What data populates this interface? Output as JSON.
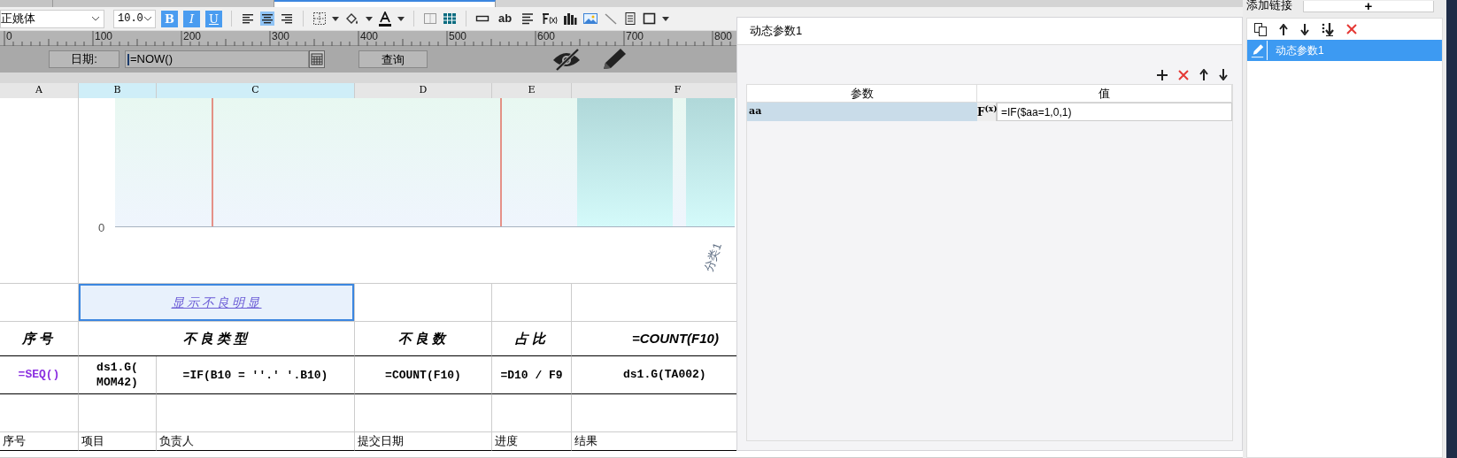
{
  "document_tabs": [
    {
      "selected": false
    },
    {
      "selected": false
    },
    {
      "selected": true
    }
  ],
  "toolbar": {
    "font": "正姚体",
    "size": "10.0",
    "format_buttons": [
      {
        "label": "B",
        "on": true
      },
      {
        "label": "I",
        "on": true
      },
      {
        "label": "U",
        "on": true
      }
    ],
    "align_buttons": [
      {
        "kind": "left",
        "selected": false
      },
      {
        "kind": "center",
        "selected": true
      },
      {
        "kind": "right",
        "selected": false
      }
    ],
    "text_tool": "ab"
  },
  "ruler": {
    "ticks": [
      "0",
      "100",
      "200",
      "300",
      "400",
      "500",
      "600",
      "700",
      "800"
    ]
  },
  "parameter_bar": {
    "label": "日期:",
    "value": "=NOW()",
    "button": "查询"
  },
  "sheet": {
    "columns": [
      {
        "label": "A",
        "selected": false
      },
      {
        "label": "B",
        "selected": true
      },
      {
        "label": "C",
        "selected": true
      },
      {
        "label": "D",
        "selected": false
      },
      {
        "label": "E",
        "selected": false
      },
      {
        "label": "F",
        "selected": false
      }
    ],
    "chart": {
      "y_tick": "0",
      "category": "分类1"
    },
    "rows": [
      {
        "cells": [
          {
            "kind": "plain",
            "selected": false
          },
          {
            "text": "显示不良明显",
            "kind": "link",
            "selected": true
          },
          {
            "kind": "merged"
          },
          {
            "kind": "plain",
            "selected": false
          },
          {
            "kind": "plain",
            "selected": false
          },
          {
            "kind": "plain",
            "selected": false
          }
        ]
      },
      {
        "cells": [
          {
            "text": "序号",
            "kind": "header",
            "selected": false
          },
          {
            "text": "不良类型",
            "kind": "header",
            "selected": false
          },
          {
            "kind": "merged"
          },
          {
            "text": "不良数",
            "kind": "header",
            "selected": false
          },
          {
            "text": "占比",
            "kind": "header",
            "selected": false
          },
          {
            "text": "=COUNT(F10)",
            "kind": "header-formula",
            "selected": false
          }
        ]
      },
      {
        "cells": [
          {
            "text": "=SEQ()",
            "kind": "sequence",
            "selected": false
          },
          {
            "text": "ds1.G(\nMOM42)",
            "kind": "formula",
            "selected": false
          },
          {
            "text": "=IF(B10 = ''.' '.B10)",
            "kind": "formula",
            "selected": false
          },
          {
            "text": "=COUNT(F10)",
            "kind": "formula",
            "selected": false
          },
          {
            "text": "=D10 / F9",
            "kind": "formula",
            "selected": false
          },
          {
            "text": "ds1.G(TA002)",
            "kind": "formula-right",
            "selected": false
          }
        ]
      },
      {
        "cells": [
          {
            "kind": "plain",
            "selected": false
          },
          {
            "kind": "plain",
            "selected": false
          },
          {
            "kind": "plain",
            "selected": false
          },
          {
            "kind": "plain",
            "selected": false
          },
          {
            "kind": "plain",
            "selected": false
          },
          {
            "kind": "plain",
            "selected": false
          }
        ]
      },
      {
        "cells": [
          {
            "text": "序号",
            "kind": "label",
            "selected": false
          },
          {
            "text": "项目",
            "kind": "label",
            "selected": false
          },
          {
            "text": "负责人",
            "kind": "label",
            "selected": false
          },
          {
            "text": "提交日期",
            "kind": "label",
            "selected": false
          },
          {
            "text": "进度",
            "kind": "label",
            "selected": false
          },
          {
            "text": "结果",
            "kind": "label",
            "selected": false
          }
        ]
      }
    ]
  },
  "dialog": {
    "title": "动态参数1",
    "columns": [
      "参数",
      "值"
    ],
    "rows": [
      {
        "name": "aa",
        "formula_button": "F$^{(x)}$",
        "value": "=IF($aa=1,0,1)",
        "selected": true
      }
    ]
  },
  "link_panel": {
    "label": "添加链接",
    "add_button": "+",
    "items": [
      {
        "label": "动态参数1",
        "selected": true
      }
    ]
  }
}
